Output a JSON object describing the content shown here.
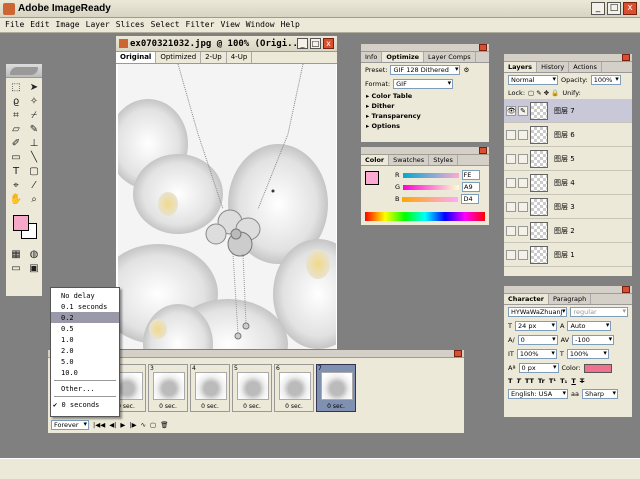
{
  "app": {
    "title": "Adobe ImageReady"
  },
  "window_buttons": [
    "_",
    "□",
    "x"
  ],
  "menu": [
    "File",
    "Edit",
    "Image",
    "Layer",
    "Slices",
    "Select",
    "Filter",
    "View",
    "Window",
    "Help"
  ],
  "document": {
    "title": "ex070321032.jpg @ 100% (Origi...",
    "tabs": [
      "Original",
      "Optimized",
      "2-Up",
      "4-Up"
    ],
    "active_tab": "Original"
  },
  "optimize_panel": {
    "tabs": [
      "Info",
      "Optimize",
      "Layer Comps"
    ],
    "preset_label": "Preset:",
    "preset_value": "GIF 128 Dithered",
    "format_label": "Format:",
    "format_value": "GIF",
    "sections": [
      "Color Table",
      "Dither",
      "Transparency",
      "Options"
    ]
  },
  "color_panel": {
    "tabs": [
      "Color",
      "Swatches",
      "Styles"
    ],
    "channels": [
      {
        "label": "R",
        "value": "FE"
      },
      {
        "label": "G",
        "value": "A9"
      },
      {
        "label": "B",
        "value": "D4"
      }
    ],
    "foreground": "#fea9d4"
  },
  "layers_panel": {
    "tabs": [
      "Layers",
      "History",
      "Actions"
    ],
    "blend_mode": "Normal",
    "opacity_label": "Opacity:",
    "opacity_value": "100%",
    "lock_label": "Lock:",
    "unify_label": "Unify:",
    "layers": [
      "图层 7",
      "图层 6",
      "图层 5",
      "图层 4",
      "图层 3",
      "图层 2",
      "图层 1"
    ]
  },
  "character_panel": {
    "tabs": [
      "Character",
      "Paragraph"
    ],
    "font": "HYWaWaZhuanJ",
    "style": "regular",
    "size": "24 px",
    "leading": "Auto",
    "kerning": "0",
    "tracking": "-100",
    "vscale": "100%",
    "hscale": "100%",
    "baseline": "0 px",
    "color_label": "Color:",
    "language": "English: USA",
    "aa_label": "aa",
    "antialias": "Sharp",
    "type_styles": [
      "T",
      "T",
      "TT",
      "Tr",
      "T¹",
      "T₁",
      "T",
      "T"
    ]
  },
  "animation_panel": {
    "frames": [
      {
        "num": "2",
        "dur": "0 sec."
      },
      {
        "num": "3",
        "dur": "0 sec."
      },
      {
        "num": "4",
        "dur": "0 sec."
      },
      {
        "num": "5",
        "dur": "0 sec."
      },
      {
        "num": "6",
        "dur": "0 sec."
      },
      {
        "num": "7",
        "dur": "0 sec."
      }
    ],
    "loop": "Forever"
  },
  "delay_menu": {
    "items": [
      "No delay",
      "0.1 seconds",
      "0.2",
      "0.5",
      "1.0",
      "2.0",
      "5.0",
      "10.0"
    ],
    "highlighted": "0.2",
    "other": "Other...",
    "checked": "0 seconds"
  }
}
